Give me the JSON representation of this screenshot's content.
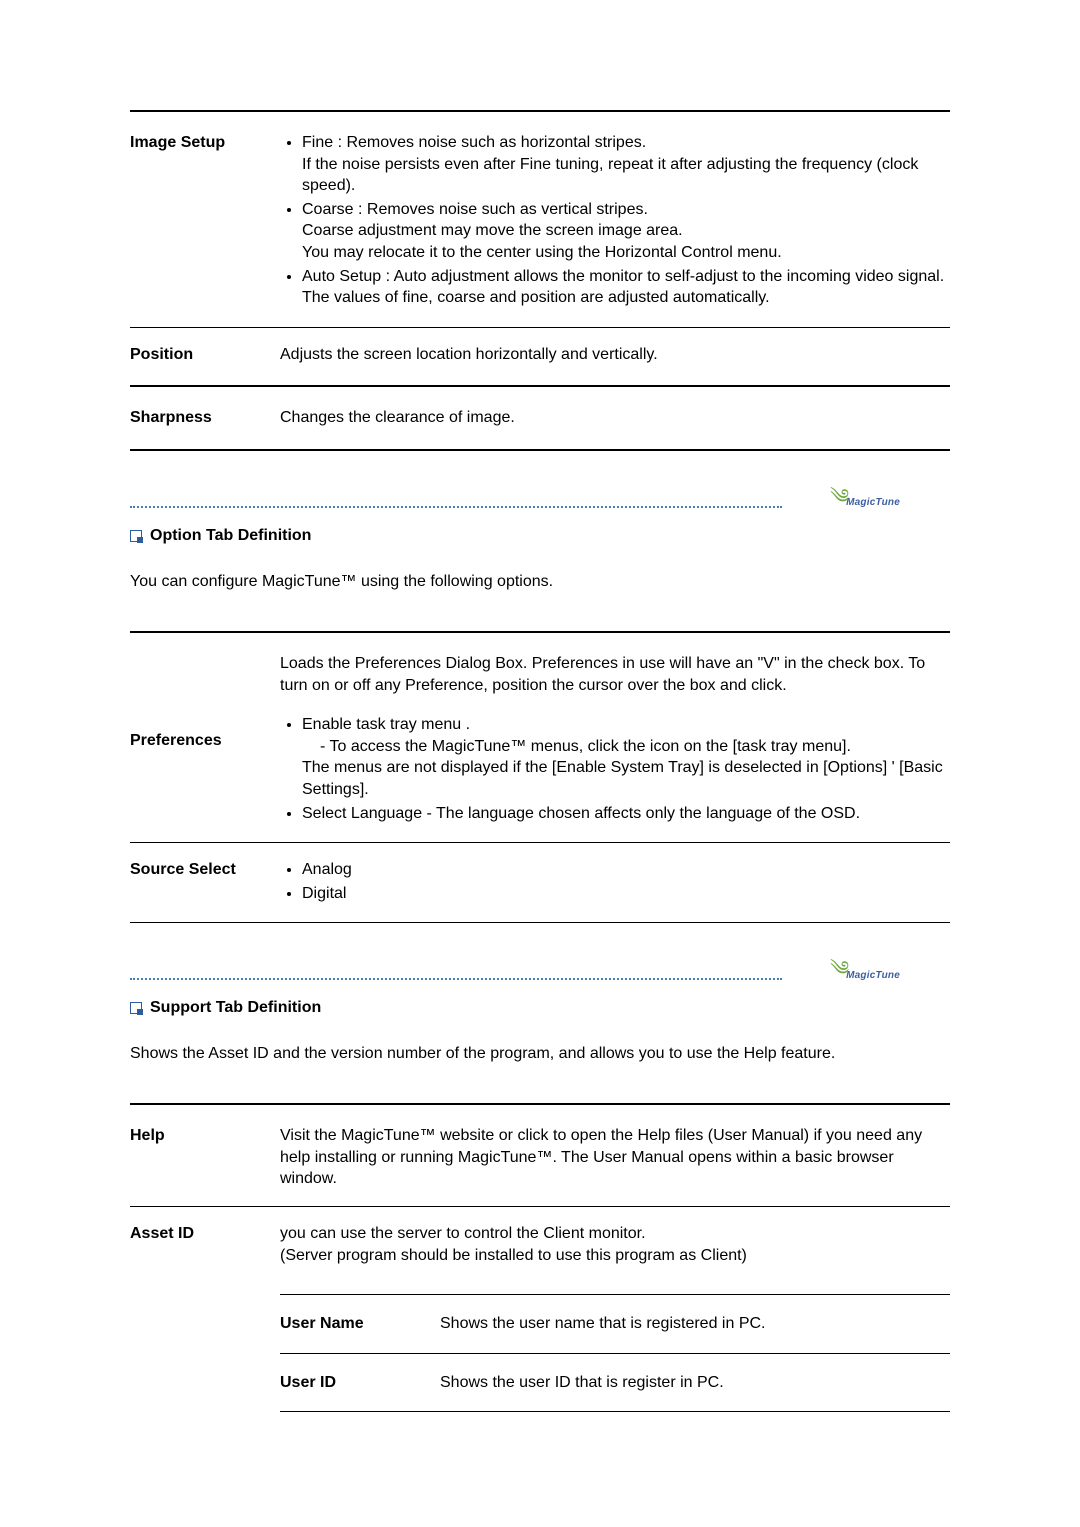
{
  "imageSetup": {
    "term": "Image Setup",
    "fine": "Fine : Removes noise such as horizontal stripes.\nIf the noise persists even after Fine tuning, repeat it after adjusting the frequency (clock speed).",
    "coarse": "Coarse : Removes noise such as vertical stripes.\nCoarse adjustment may move the screen image area.\nYou may relocate it to the center using the Horizontal Control menu.",
    "auto": "Auto Setup : Auto adjustment allows the monitor to self-adjust to the incoming video signal. The values of fine, coarse and position are adjusted automatically."
  },
  "position": {
    "term": "Position",
    "body": "Adjusts the screen location horizontally and vertically."
  },
  "sharpness": {
    "term": "Sharpness",
    "body": "Changes the clearance of image."
  },
  "logoText": "MagicTune",
  "optionHeading": "Option Tab Definition",
  "optionIntro": "You can configure MagicTune™ using the following options.",
  "preferences": {
    "term": "Preferences",
    "lead": "Loads the Preferences Dialog Box. Preferences in use will have an \"V\" in the check box. To turn on or off any Preference, position the cursor over the box and click.",
    "enableTrayTitle": "Enable task tray menu .",
    "enableTrayLine1": "- To access the MagicTune™ menus, click the icon on the [task tray menu].",
    "enableTrayLine2": " The menus are not displayed if the [Enable System Tray] is deselected in [Options] ' [Basic Settings].",
    "selectLanguage": "Select Language - The language chosen affects only the language of the OSD."
  },
  "sourceSelect": {
    "term": "Source Select",
    "analog": "Analog",
    "digital": "Digital"
  },
  "supportHeading": "Support Tab Definition",
  "supportIntro": "Shows the Asset ID and the version number of the program, and allows you to use the Help feature.",
  "help": {
    "term": "Help",
    "body": "Visit the MagicTune™ website or click to open the Help files (User Manual) if you need any help installing or running MagicTune™. The User Manual opens within a basic browser window."
  },
  "assetId": {
    "term": "Asset ID",
    "lead": "you can use the server to control the Client monitor.\n(Server program should be installed to use this program as Client)",
    "userNameTerm": "User Name",
    "userNameBody": "Shows the user name that is registered in PC.",
    "userIdTerm": "User ID",
    "userIdBody": "Shows the user ID that is register in PC."
  }
}
